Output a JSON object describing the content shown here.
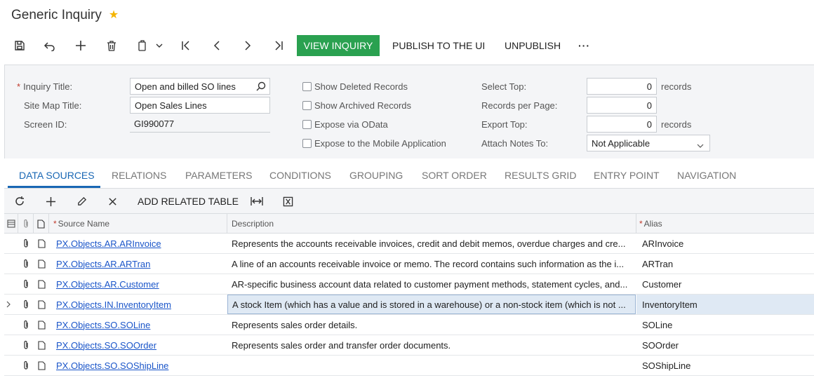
{
  "header": {
    "title": "Generic Inquiry",
    "favorite_icon": "star-icon"
  },
  "toolbar": {
    "icons": [
      "save-icon",
      "undo-icon",
      "add-icon",
      "delete-icon",
      "copy-paste-icon",
      "first-icon",
      "prev-icon",
      "next-icon",
      "last-icon"
    ],
    "view_inquiry": "VIEW INQUIRY",
    "publish": "PUBLISH TO THE UI",
    "unpublish": "UNPUBLISH",
    "more": "···"
  },
  "form": {
    "inquiry_title_label": "Inquiry Title:",
    "inquiry_title_value": "Open and billed SO lines",
    "site_map_title_label": "Site Map Title:",
    "site_map_title_value": "Open Sales Lines",
    "screen_id_label": "Screen ID:",
    "screen_id_value": "GI990077",
    "show_deleted": "Show Deleted Records",
    "show_archived": "Show Archived Records",
    "expose_odata": "Expose via OData",
    "expose_mobile": "Expose to the Mobile Application",
    "select_top_label": "Select Top:",
    "select_top_value": "0",
    "records_per_page_label": "Records per Page:",
    "records_per_page_value": "0",
    "export_top_label": "Export Top:",
    "export_top_value": "0",
    "records_unit": "records",
    "attach_notes_label": "Attach Notes To:",
    "attach_notes_value": "Not Applicable"
  },
  "tabs": [
    "DATA SOURCES",
    "RELATIONS",
    "PARAMETERS",
    "CONDITIONS",
    "GROUPING",
    "SORT ORDER",
    "RESULTS GRID",
    "ENTRY POINT",
    "NAVIGATION"
  ],
  "grid_toolbar": {
    "add_related_table": "ADD RELATED TABLE"
  },
  "grid": {
    "columns": {
      "source_name": "Source Name",
      "description": "Description",
      "alias": "Alias"
    },
    "rows": [
      {
        "source": "PX.Objects.AR.ARInvoice",
        "description": "Represents the accounts receivable invoices, credit and debit memos, overdue charges and cre...",
        "alias": "ARInvoice"
      },
      {
        "source": "PX.Objects.AR.ARTran",
        "description": "A line of an accounts receivable invoice or memo. The record contains such information as the i...",
        "alias": "ARTran"
      },
      {
        "source": "PX.Objects.AR.Customer",
        "description": "AR-specific business account data related to customer payment methods, statement cycles, and...",
        "alias": "Customer"
      },
      {
        "source": "PX.Objects.IN.InventoryItem",
        "description": "A stock Item (which has a value and is stored in a warehouse) or a non-stock item (which is not ...",
        "alias": "InventoryItem"
      },
      {
        "source": "PX.Objects.SO.SOLine",
        "description": "Represents sales order details.",
        "alias": "SOLine"
      },
      {
        "source": "PX.Objects.SO.SOOrder",
        "description": "Represents sales order and transfer order documents.",
        "alias": "SOOrder"
      },
      {
        "source": "PX.Objects.SO.SOShipLine",
        "description": "",
        "alias": "SOShipLine"
      }
    ]
  }
}
